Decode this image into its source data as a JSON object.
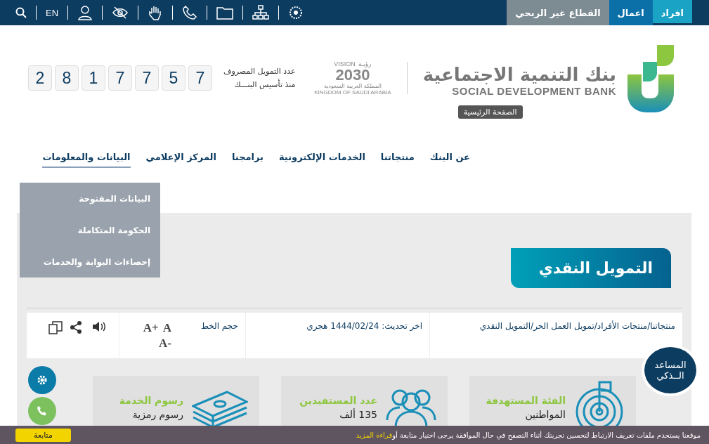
{
  "top_bar": {
    "segments": [
      {
        "label": "افراد",
        "selected": true,
        "color": "#1ba3c6"
      },
      {
        "label": "اعمال",
        "selected": false,
        "color": "#0b6fa8"
      },
      {
        "label": "القطاع غير الربحي",
        "selected": false,
        "color": "#7d8b93"
      }
    ],
    "language": "EN"
  },
  "header": {
    "logo": {
      "arabic": "بنك التنمية الاجتماعية",
      "english": "SOCIAL DEVELOPMENT BANK",
      "tooltip": "الصفحة الرئيسية"
    },
    "vision": {
      "arabic": "رؤيـة",
      "label": "VISION",
      "year": "2030",
      "country_ar": "المملكة العربية السعودية",
      "country_en": "KINGDOM OF SAUDI ARABIA"
    },
    "counter": {
      "label_lines": [
        "عدد التمويل المصروف",
        "منذ تأسيس البنـــك"
      ],
      "digits": [
        "7",
        "5",
        "7",
        "7",
        "1",
        "8",
        "2"
      ]
    }
  },
  "nav": [
    {
      "label": "عن البنك",
      "selected": false
    },
    {
      "label": "منتجاتنا",
      "selected": false
    },
    {
      "label": "الخدمات الإلكترونية",
      "selected": false
    },
    {
      "label": "برامجنا",
      "selected": false
    },
    {
      "label": "المركز الإعلامي",
      "selected": false
    },
    {
      "label": "البيانات والمعلومات",
      "selected": true
    }
  ],
  "dropdown": [
    "البيانات المفتوحة",
    "الحكومة المتكاملة",
    "إحصاءات البوابة والخدمات"
  ],
  "page_title": "التمويل النقدي",
  "info_bar": {
    "breadcrumb": "منتجاتنا/منتجات الأفراد/تمويل العمل الحر/التمويل النقدي",
    "updated": "اخر تحديث: 1444/02/24 هجري",
    "font_size_label": "حجم الخط",
    "font_buttons": [
      "A+",
      "A",
      "A-"
    ]
  },
  "cards": [
    {
      "kind": "target",
      "title": "الفئة المستهدفة",
      "value": "المواطنين"
    },
    {
      "kind": "people",
      "title": "عدد المستفيدين",
      "value": "135 ألف"
    },
    {
      "kind": "money",
      "title": "رسوم الخدمة",
      "value": "رسوم رمزية"
    }
  ],
  "chatbot": [
    "المساعد",
    "الــذكي"
  ],
  "cookie_bar": {
    "text": "موقعنا يستخدم ملفات تعريف الارتباط لتحسين تجربتك أثناء التصفح في حال الموافقة يرجى اختيار متابعة أو",
    "link": "قراءة المزيد",
    "button": "متابعة"
  }
}
